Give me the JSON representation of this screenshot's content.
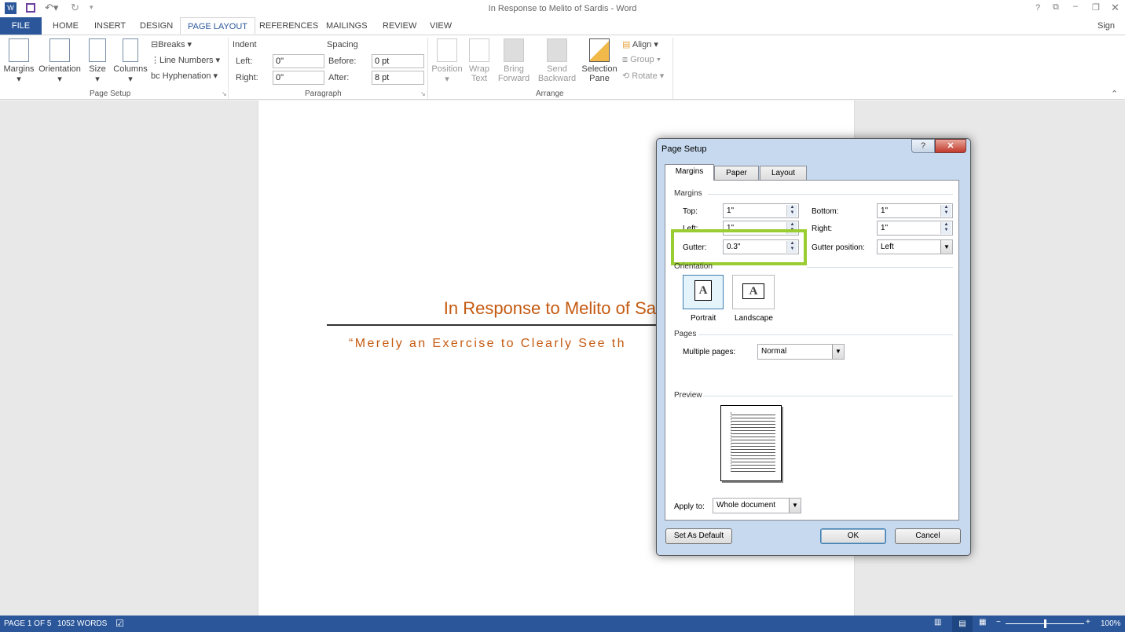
{
  "window": {
    "title": "In Response to Melito of Sardis - Word",
    "sign_in": "Sign in",
    "controls": [
      "?",
      "restore-ribbon",
      "minimize",
      "maximize",
      "close"
    ]
  },
  "qat": {
    "icons": [
      "word-icon",
      "save-icon",
      "undo-icon",
      "redo-icon",
      "customize-icon"
    ]
  },
  "tabs": [
    {
      "label": "FILE"
    },
    {
      "label": "HOME"
    },
    {
      "label": "INSERT"
    },
    {
      "label": "DESIGN"
    },
    {
      "label": "PAGE LAYOUT",
      "active": true
    },
    {
      "label": "REFERENCES"
    },
    {
      "label": "MAILINGS"
    },
    {
      "label": "REVIEW"
    },
    {
      "label": "VIEW"
    }
  ],
  "ribbon": {
    "page_setup": {
      "label": "Page Setup",
      "margins": "Margins",
      "orientation": "Orientation",
      "size": "Size",
      "columns": "Columns",
      "breaks": "Breaks",
      "line_numbers": "Line Numbers",
      "hyphenation": "Hyphenation"
    },
    "paragraph": {
      "label": "Paragraph",
      "indent": "Indent",
      "spacing": "Spacing",
      "left_label": "Left:",
      "left": "0\"",
      "right_label": "Right:",
      "right": "0\"",
      "before_label": "Before:",
      "before": "0 pt",
      "after_label": "After:",
      "after": "8 pt"
    },
    "arrange": {
      "label": "Arrange",
      "position": "Position",
      "wrap_text": [
        "Wrap",
        "Text"
      ],
      "bring_forward": [
        "Bring",
        "Forward"
      ],
      "send_backward": [
        "Send",
        "Backward"
      ],
      "selection_pane": [
        "Selection",
        "Pane"
      ],
      "align": "Align",
      "group": "Group",
      "rotate": "Rotate"
    }
  },
  "document": {
    "title": "In Response to Melito of Sa",
    "subtitle": "“Merely an Exercise to Clearly See th"
  },
  "status": {
    "page": "PAGE 1 OF 5",
    "words": "1052 WORDS",
    "zoom": "100%",
    "zoom_level": 100
  },
  "dialog": {
    "title": "Page Setup",
    "tabs": [
      "Margins",
      "Paper",
      "Layout"
    ],
    "margins_section": "Margins",
    "top_label": "Top:",
    "top": "1\"",
    "bottom_label": "Bottom:",
    "bottom": "1\"",
    "left_label": "Left:",
    "left": "1\"",
    "right_label": "Right:",
    "right": "1\"",
    "gutter_label": "Gutter:",
    "gutter": "0.3\"",
    "gutter_pos_label": "Gutter position:",
    "gutter_pos": "Left",
    "orientation_section": "Orientation",
    "portrait": "Portrait",
    "landscape": "Landscape",
    "pages_section": "Pages",
    "multiple_pages_label": "Multiple pages:",
    "multiple_pages": "Normal",
    "preview_section": "Preview",
    "apply_to_label": "Apply to:",
    "apply_to": "Whole document",
    "set_default": "Set As Default",
    "ok": "OK",
    "cancel": "Cancel",
    "highlight_color": "#9acd32"
  }
}
